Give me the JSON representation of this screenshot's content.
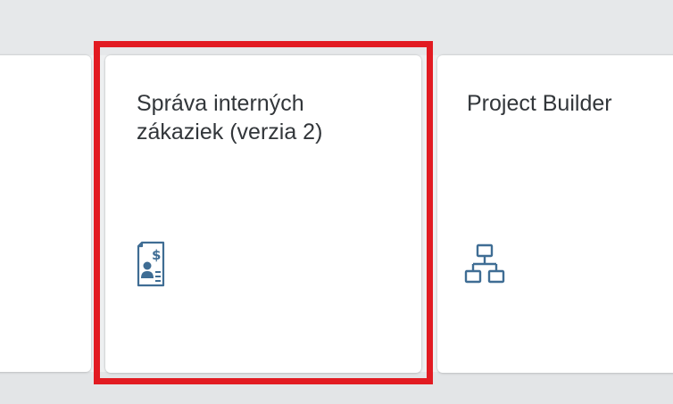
{
  "tiles": [
    {
      "title_line1": "Správa interných",
      "title_line2": "zákaziek (verzia 2)",
      "icon": "customer-contract-icon",
      "selected": true
    },
    {
      "title": "Project Builder",
      "icon": "hierarchy-icon"
    }
  ],
  "colors": {
    "highlight": "#e21b22",
    "icon": "#3f6d94",
    "title_text": "#32363a",
    "tile_bg": "#ffffff",
    "page_bg": "#eef0f1"
  }
}
